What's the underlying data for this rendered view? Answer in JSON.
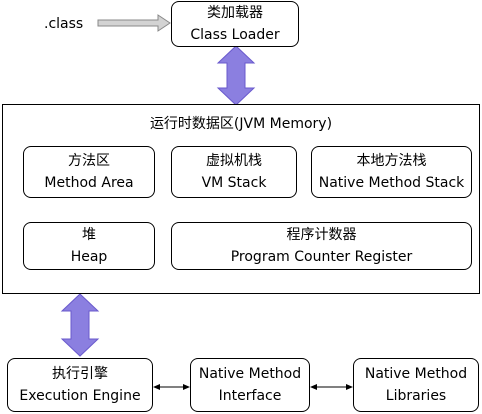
{
  "file_label": ".class",
  "class_loader": {
    "line1": "类加载器",
    "line2": "Class Loader"
  },
  "jvm_memory": {
    "title": "运行时数据区(JVM Memory)",
    "method_area": {
      "line1": "方法区",
      "line2": "Method Area"
    },
    "vm_stack": {
      "line1": "虚拟机栈",
      "line2": "VM Stack"
    },
    "native_method_stack": {
      "line1": "本地方法栈",
      "line2": "Native Method Stack"
    },
    "heap": {
      "line1": "堆",
      "line2": "Heap"
    },
    "program_counter": {
      "line1": "程序计数器",
      "line2": "Program Counter Register"
    }
  },
  "execution_engine": {
    "line1": "执行引擎",
    "line2": "Execution Engine"
  },
  "native_interface": {
    "line1": "Native Method",
    "line2": "Interface"
  },
  "native_libraries": {
    "line1": "Native Method",
    "line2": "Libraries"
  },
  "colors": {
    "double_arrow_fill": "#8b7fe0",
    "double_arrow_stroke": "#6a5acd",
    "file_arrow_fill": "#d3d3d3",
    "file_arrow_stroke": "#888888",
    "line": "#000000"
  }
}
